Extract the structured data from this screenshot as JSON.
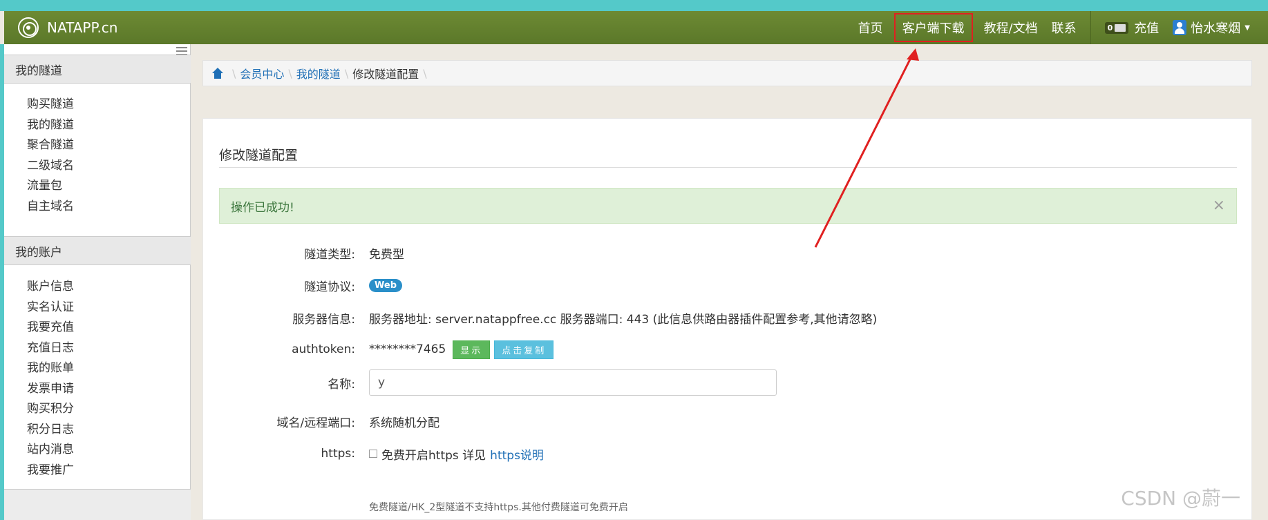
{
  "navbar": {
    "brand": "NATAPP.cn",
    "items": [
      {
        "label": "首页"
      },
      {
        "label": "客户端下载"
      },
      {
        "label": "教程/文档"
      },
      {
        "label": "联系"
      }
    ],
    "mail_count": "0",
    "recharge": "充值",
    "user": "怡水寒烟"
  },
  "sidebar": {
    "sections": [
      {
        "title": "我的隧道",
        "items": [
          "购买隧道",
          "我的隧道",
          "聚合隧道",
          "二级域名",
          "流量包",
          "自主域名"
        ]
      },
      {
        "title": "我的账户",
        "items": [
          "账户信息",
          "实名认证",
          "我要充值",
          "充值日志",
          "我的账单",
          "发票申请",
          "购买积分",
          "积分日志",
          "站内消息",
          "我要推广"
        ]
      }
    ]
  },
  "breadcrumb": {
    "items": [
      "会员中心",
      "我的隧道"
    ],
    "current": "修改隧道配置"
  },
  "panel": {
    "title": "修改隧道配置",
    "alert": "操作已成功!",
    "alert_close": "×"
  },
  "form": {
    "tunnel_type_label": "隧道类型:",
    "tunnel_type": "免费型",
    "protocol_label": "隧道协议:",
    "protocol": "Web",
    "server_label": "服务器信息:",
    "server_info": "服务器地址: server.natappfree.cc 服务器端口: 443 (此信息供路由器插件配置参考,其他请忽略)",
    "authtoken_label": "authtoken:",
    "authtoken": "********7465",
    "show_btn": "显示",
    "copy_btn": "点击复制",
    "name_label": "名称:",
    "name_value": "y",
    "domain_label": "域名/远程端口:",
    "domain_value": "系统随机分配",
    "https_label": "https:",
    "https_text": "免费开启https 详见",
    "https_link": "https说明",
    "https_help": "免费隧道/HK_2型隧道不支持https.其他付费隧道可免费开启"
  },
  "watermark": "CSDN @蔚一",
  "colors": {
    "navbar": "#6d8a34",
    "accent_link": "#1f6fb6",
    "alert_bg": "#dff0d8",
    "annotation_red": "#e02020"
  }
}
